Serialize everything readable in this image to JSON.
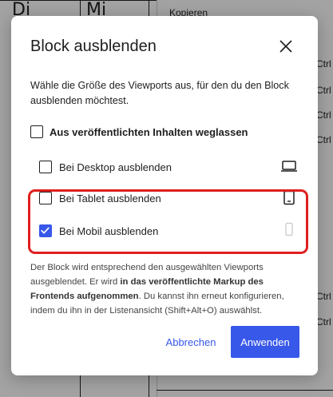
{
  "background": {
    "columns": [
      "Di",
      "Mi"
    ],
    "menu_item": "Kopieren",
    "shortcuts": [
      "Ctrl",
      "Ctrl",
      "Ctrl",
      "Ctrl",
      "Ctrl",
      "Ctrl"
    ]
  },
  "modal": {
    "title": "Block ausblenden",
    "close_icon": "close-icon",
    "description": "Wähle die Größe des Viewports aus, für den du den Block ausblenden möchtest.",
    "exclude": {
      "label": "Aus veröffentlichten Inhalten weglassen",
      "checked": false
    },
    "options": [
      {
        "label": "Bei Desktop ausblenden",
        "checked": false,
        "icon": "desktop-icon"
      },
      {
        "label": "Bei Tablet ausblenden",
        "checked": false,
        "icon": "tablet-icon"
      },
      {
        "label": "Bei Mobil ausblenden",
        "checked": true,
        "icon": "mobile-icon"
      }
    ],
    "note": {
      "part1": "Der Block wird entsprechend den ausgewählten Viewports ausgeblendet. Er wird ",
      "bold": "in das veröffentlichte Markup des Frontends aufgenommen",
      "part2": ". Du kannst ihn erneut konfigurieren, indem du ihn in der Listenansicht (Shift+Alt+O) auswählst."
    },
    "cancel_label": "Abbrechen",
    "confirm_label": "Anwenden",
    "accent_color": "#3858e9",
    "highlight_color": "#e01e1e"
  }
}
